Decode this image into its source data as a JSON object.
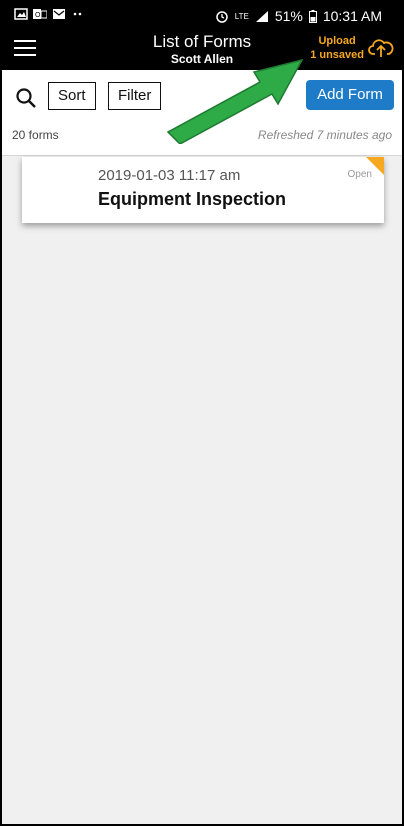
{
  "status_bar": {
    "battery": "51%",
    "time": "10:31 AM",
    "network": "LTE"
  },
  "header": {
    "title": "List of Forms",
    "subtitle": "Scott Allen",
    "upload_label": "Upload",
    "unsaved_label": "1 unsaved"
  },
  "toolbar": {
    "sort_label": "Sort",
    "filter_label": "Filter",
    "add_label": "Add Form",
    "count_text": "20 forms",
    "refreshed_text": "Refreshed 7 minutes ago"
  },
  "forms": [
    {
      "date": "2019-01-03 11:17 am",
      "name": "Equipment Inspection",
      "status": "Open"
    }
  ],
  "colors": {
    "accent": "#f7a821",
    "primary": "#1e7bc8",
    "arrow": "#2eaa47"
  }
}
